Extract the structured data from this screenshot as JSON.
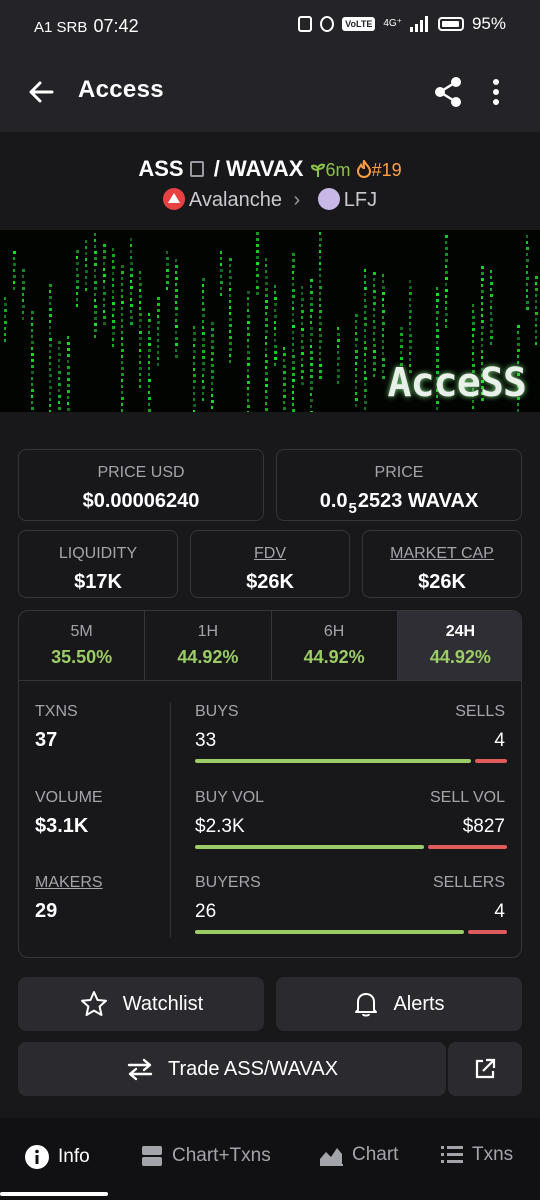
{
  "status_bar": {
    "carrier": "A1 SRB",
    "time": "07:42",
    "network": "4G⁺",
    "volte": "VoLTE",
    "battery": "95%"
  },
  "app_bar": {
    "title": "Access"
  },
  "pair": {
    "base": "ASS",
    "separator": "/",
    "quote": "WAVAX",
    "age": "6m",
    "rank": "#19",
    "chain": "Avalanche",
    "dex": "LFJ"
  },
  "banner": {
    "text": "AcceSS"
  },
  "price": {
    "usd_label": "PRICE USD",
    "usd_value": "$0.00006240",
    "native_label": "PRICE",
    "native_prefix": "0.0",
    "native_zeros": "5",
    "native_suffix": "2523 WAVAX"
  },
  "metrics": {
    "liquidity_label": "LIQUIDITY",
    "liquidity_value": "$17K",
    "fdv_label": "FDV",
    "fdv_value": "$26K",
    "mcap_label": "MARKET CAP",
    "mcap_value": "$26K"
  },
  "tabs": [
    {
      "label": "5M",
      "value": "35.50%"
    },
    {
      "label": "1H",
      "value": "44.92%"
    },
    {
      "label": "6H",
      "value": "44.92%"
    },
    {
      "label": "24H",
      "value": "44.92%"
    }
  ],
  "active_tab": "24H",
  "stats": {
    "txns_label": "TXNS",
    "txns_value": "37",
    "volume_label": "VOLUME",
    "volume_value": "$3.1K",
    "makers_label": "MAKERS",
    "makers_value": "29",
    "buys_label": "BUYS",
    "buys_value": "33",
    "sells_label": "SELLS",
    "sells_value": "4",
    "buyvol_label": "BUY VOL",
    "buyvol_value": "$2.3K",
    "sellvol_label": "SELL VOL",
    "sellvol_value": "$827",
    "buyers_label": "BUYERS",
    "buyers_value": "26",
    "sellers_label": "SELLERS",
    "sellers_value": "4"
  },
  "ratios": {
    "buys": 0.89,
    "buy_vol": 0.74,
    "buyers": 0.87
  },
  "buttons": {
    "watchlist": "Watchlist",
    "alerts": "Alerts",
    "trade": "Trade ASS/WAVAX"
  },
  "nav": {
    "info": "Info",
    "chart_txns": "Chart+Txns",
    "chart": "Chart",
    "txns": "Txns"
  },
  "colors": {
    "green": "#9ccc65",
    "red": "#e05b5b",
    "orange": "#ff9f43",
    "background": "#18181b"
  }
}
